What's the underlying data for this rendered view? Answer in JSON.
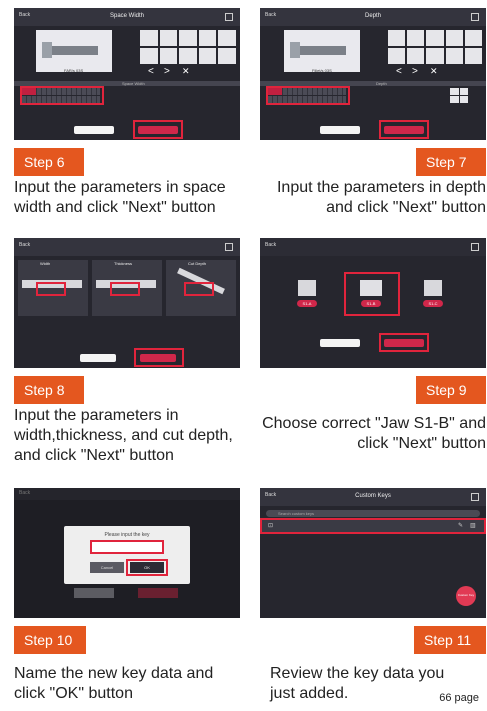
{
  "screens": {
    "s6": {
      "back": "Back",
      "title": "Space Width",
      "key_label": "FAR/s 03S",
      "table_header": "Space Width"
    },
    "s7": {
      "back": "Back",
      "title": "Depth",
      "key_label": "Fillet/s 03S",
      "table_header": "Depth"
    },
    "s8": {
      "back": "Back",
      "tabs": [
        "Width",
        "Thickness",
        "Cut Depth"
      ]
    },
    "s9": {
      "back": "Back",
      "jaws": [
        "S1-A",
        "S1-B",
        "S1-C"
      ]
    },
    "s10": {
      "back": "Back",
      "dialog_prompt": "Please input the key",
      "cancel": "Cancel",
      "ok": "OK"
    },
    "s11": {
      "back": "Back",
      "title": "Custom Keys",
      "search_placeholder": "Search custom keys",
      "fab": "Custom Key"
    }
  },
  "steps": {
    "s6": {
      "label": "Step 6",
      "text": "Input the parameters in space width and click \"Next\" button"
    },
    "s7": {
      "label": "Step 7",
      "text": "Input the parameters in depth and click \"Next\" button"
    },
    "s8": {
      "label": "Step 8",
      "text": "Input the parameters in width,thickness, and cut depth, and click \"Next\" button"
    },
    "s9": {
      "label": "Step 9",
      "text": "Choose correct \"Jaw S1-B\" and click \"Next\" button"
    },
    "s10": {
      "label": "Step 10",
      "text": "Name the new key data and click \"OK\" button"
    },
    "s11": {
      "label": "Step 11",
      "text": "Review the key data you just added."
    }
  },
  "page_number": "66 page",
  "colors": {
    "step_bg": "#e4571f",
    "screen_bg": "#26262e",
    "highlight": "#e0243c",
    "accent": "#d0274a"
  }
}
